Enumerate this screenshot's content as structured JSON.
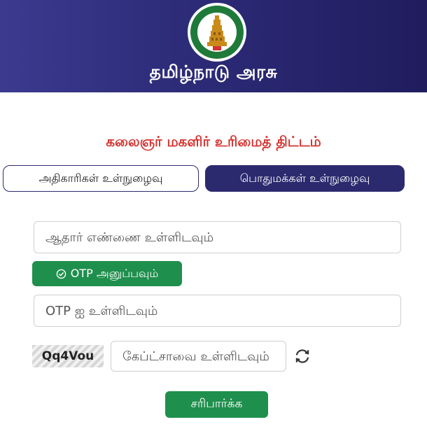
{
  "header": {
    "emblem_icon": "tamil-nadu-emblem",
    "gov_title": "தமிழ்நாடு அரசு",
    "background": "#2f2e7c"
  },
  "scheme_title": "கலைஞர் மகளிர் உரிமைத் திட்டம்",
  "tabs": {
    "officials": "அதிகாரிகள் உள்நுழைவு",
    "public": "பொதுமக்கள் உள்நுழைவு",
    "active": "public"
  },
  "form": {
    "aadhaar_placeholder": "ஆதார் எண்ணை உள்ளிடவும்",
    "aadhaar_value": "",
    "send_otp_label": "OTP அனுப்பவும்",
    "otp_placeholder": "OTP ஐ உள்ளிடவும்",
    "otp_value": "",
    "captcha_code": "Qq4Vou",
    "captcha_placeholder": "கேப்ட்சாவை உள்ளிடவும்",
    "captcha_value": "",
    "verify_label": "சரிபார்க்க"
  },
  "colors": {
    "accent_green": "#1f8f4d",
    "title_red": "#d4322f",
    "tab_active": "#2c2a6e"
  },
  "icons": {
    "send_otp": "check-circle-icon",
    "captcha_refresh": "refresh-icon"
  }
}
